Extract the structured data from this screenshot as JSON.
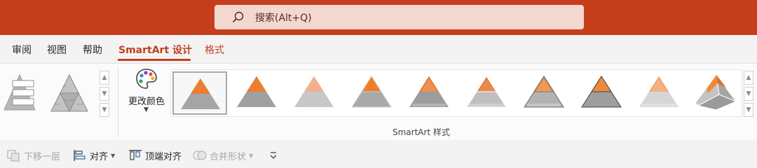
{
  "search": {
    "placeholder": "搜索(Alt+Q)"
  },
  "tabs": [
    {
      "label": "审阅"
    },
    {
      "label": "视图"
    },
    {
      "label": "帮助"
    },
    {
      "label": "SmartArt 设计"
    },
    {
      "label": "格式"
    }
  ],
  "ribbon": {
    "change_colors_label": "更改颜色",
    "smartart_styles_group_label": "SmartArt 样式",
    "style_count": 10,
    "selected_style_index": 0
  },
  "toolbar": {
    "send_backward": "下移一层",
    "align": "对齐",
    "align_top": "顶端对齐",
    "merge_shapes": "合并形状"
  },
  "colors": {
    "title_bar": "#c43e1c",
    "accent": "#c43e1c",
    "pyramid_top": "#ed7d31",
    "pyramid_base": "#a5a5a5"
  }
}
